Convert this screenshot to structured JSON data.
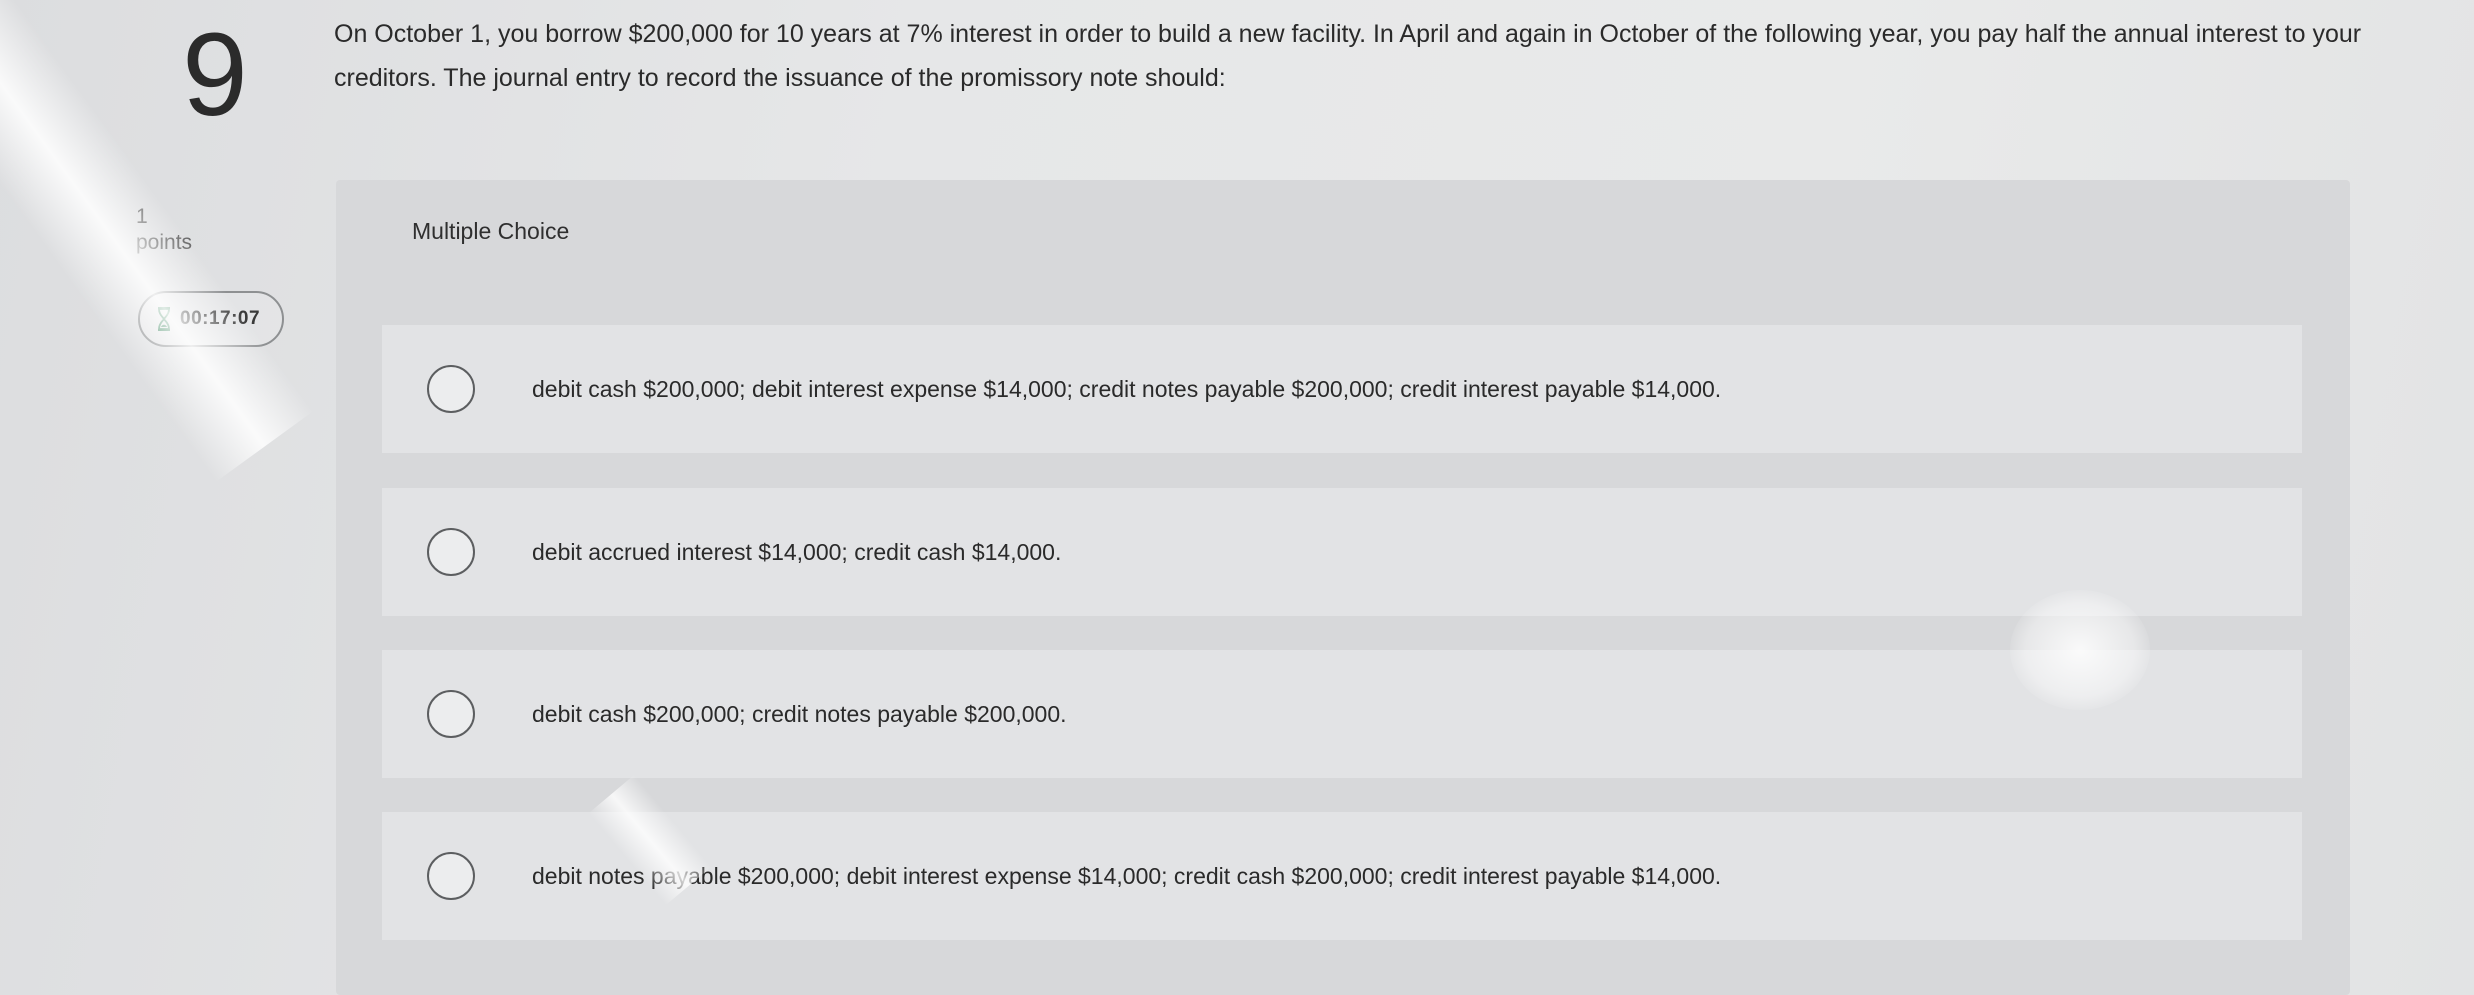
{
  "question": {
    "number": "9",
    "points_value": "1",
    "points_label": "points",
    "timer": "00:17:07",
    "text": "On October 1, you borrow $200,000 for 10 years at 7% interest in order to build a new facility. In April and again in October of the following year, you pay half the annual interest to your creditors. The journal entry to record the issuance of the promissory note should:"
  },
  "multiple_choice": {
    "label": "Multiple Choice",
    "options": [
      {
        "text": "debit cash $200,000; debit interest expense $14,000; credit notes payable $200,000; credit interest payable $14,000.",
        "selected": false
      },
      {
        "text": "debit accrued interest $14,000; credit cash $14,000.",
        "selected": false
      },
      {
        "text": "debit cash $200,000; credit notes payable $200,000.",
        "selected": false
      },
      {
        "text": "debit notes payable $200,000; debit interest expense $14,000; credit cash $200,000; credit interest payable $14,000.",
        "selected": false
      }
    ]
  },
  "icons": {
    "timer": "hourglass-icon",
    "option_control": "radio-button-icon"
  },
  "colors": {
    "background": "#e4e5e6",
    "panel": "#d7d8da",
    "option_background": "#e2e3e5",
    "text": "#2a2a2a",
    "timer_icon": "#2e7d52"
  }
}
